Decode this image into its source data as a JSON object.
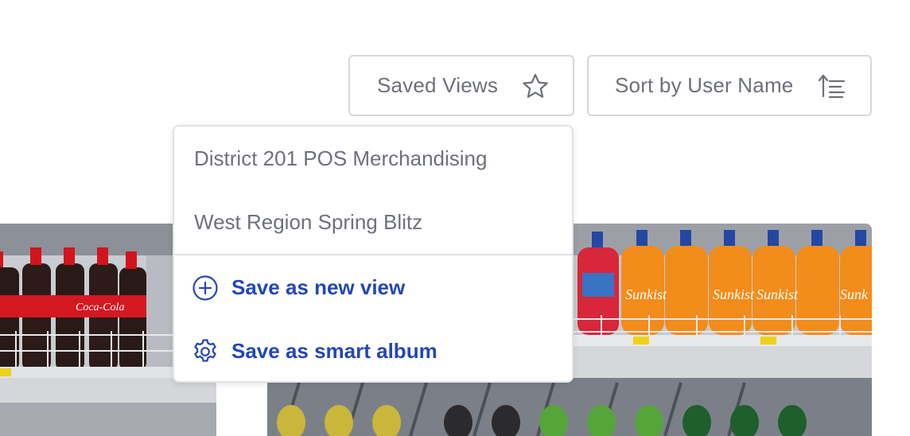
{
  "toolbar": {
    "saved_views_label": "Saved Views",
    "saved_views_icon": "star-outline-icon",
    "sort_label": "Sort by User Name",
    "sort_icon": "sort-ascending-icon"
  },
  "saved_views_menu": {
    "views": [
      {
        "label": "District 201 POS Merchandising"
      },
      {
        "label": "West Region Spring Blitz"
      }
    ],
    "actions": [
      {
        "label": "Save as new view",
        "icon": "plus-circle-icon"
      },
      {
        "label": "Save as smart album",
        "icon": "gear-icon"
      }
    ]
  },
  "photos": [
    {
      "subject": "Coca-Cola bottles on store shelf"
    },
    {
      "subject": "Sunkist and Hawaiian Punch bottles on store shelf"
    }
  ],
  "colors": {
    "button_text": "#6d7079",
    "button_border": "#d6d8dd",
    "menu_text": "#6e717a",
    "action_text": "#2447b4"
  }
}
